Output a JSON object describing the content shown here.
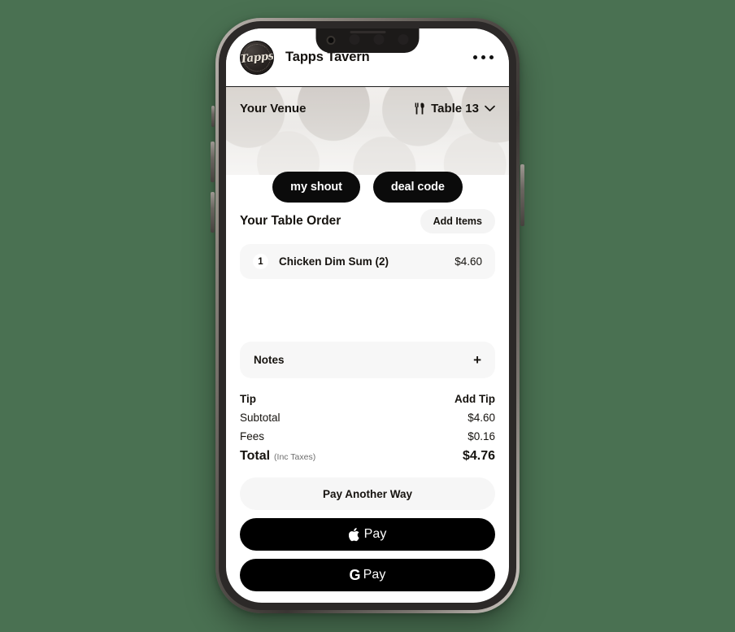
{
  "theme": {
    "page_background": "#4a7152",
    "accent_dark": "#0b0b0b",
    "surface_light": "#f7f7f7",
    "text_primary": "#16130f"
  },
  "header": {
    "venue_logo_text": "Tapps",
    "venue_name": "Tapps Tavern",
    "more_menu_icon": "more-horizontal-icon"
  },
  "banner": {
    "venue_label": "Your Venue",
    "table_icon": "cutlery-icon",
    "table_label": "Table 13",
    "chevron_icon": "chevron-down-icon"
  },
  "actions": {
    "my_shout": "my shout",
    "deal_code": "deal code"
  },
  "order": {
    "title": "Your Table Order",
    "add_items_label": "Add Items",
    "items": [
      {
        "qty": "1",
        "name": "Chicken Dim Sum (2)",
        "price": "$4.60"
      }
    ]
  },
  "notes": {
    "label": "Notes",
    "add_icon": "+"
  },
  "totals": {
    "tip_label": "Tip",
    "tip_action": "Add Tip",
    "subtotal_label": "Subtotal",
    "subtotal_value": "$4.60",
    "fees_label": "Fees",
    "fees_value": "$0.16",
    "total_label": "Total",
    "total_note": "(Inc Taxes)",
    "total_value": "$4.76"
  },
  "payments": {
    "another_way": "Pay Another Way",
    "apple_pay_label": "Pay",
    "apple_icon": "apple-logo-icon",
    "gpay_g": "G",
    "gpay_label": "Pay"
  }
}
